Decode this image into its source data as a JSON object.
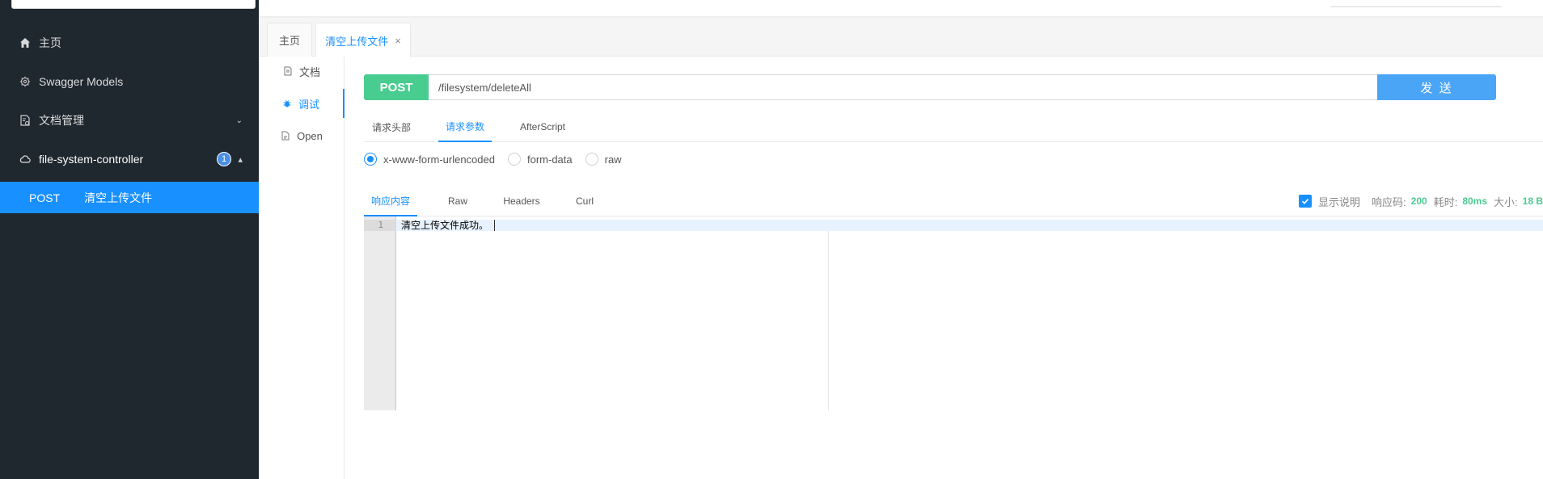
{
  "sidebar": {
    "items": [
      {
        "label": "主页",
        "icon": "home-icon"
      },
      {
        "label": "Swagger Models",
        "icon": "gear-icon"
      },
      {
        "label": "文档管理",
        "icon": "document-settings-icon"
      },
      {
        "label": "file-system-controller",
        "icon": "cloud-icon",
        "badge": "1"
      }
    ],
    "active_api": {
      "method": "POST",
      "label": "清空上传文件"
    }
  },
  "tabs": [
    {
      "label": "主页"
    },
    {
      "label": "清空上传文件",
      "close": "×"
    }
  ],
  "side_nav": [
    {
      "label": "文档",
      "icon": "document-icon"
    },
    {
      "label": "调试",
      "icon": "bug-icon"
    },
    {
      "label": "Open",
      "icon": "file-icon"
    }
  ],
  "request": {
    "method": "POST",
    "url": "/filesystem/deleteAll",
    "send_label": "发 送"
  },
  "request_tabs": [
    {
      "label": "请求头部"
    },
    {
      "label": "请求参数"
    },
    {
      "label": "AfterScript"
    }
  ],
  "body_types": [
    {
      "label": "x-www-form-urlencoded",
      "selected": true
    },
    {
      "label": "form-data",
      "selected": false
    },
    {
      "label": "raw",
      "selected": false
    }
  ],
  "response_tabs": [
    {
      "label": "响应内容"
    },
    {
      "label": "Raw"
    },
    {
      "label": "Headers"
    },
    {
      "label": "Curl"
    }
  ],
  "response_meta": {
    "show_desc_label": "显示说明",
    "code_label": "响应码:",
    "code_value": "200",
    "time_label": "耗时:",
    "time_value": "80ms",
    "size_label": "大小:",
    "size_value": "18 B"
  },
  "editor": {
    "line_number": "1",
    "content": "清空上传文件成功。"
  },
  "colors": {
    "sidebar_bg": "#1f272f",
    "accent": "#1890ff",
    "post_green": "#49cc90",
    "send_blue": "#4ba5f7"
  }
}
